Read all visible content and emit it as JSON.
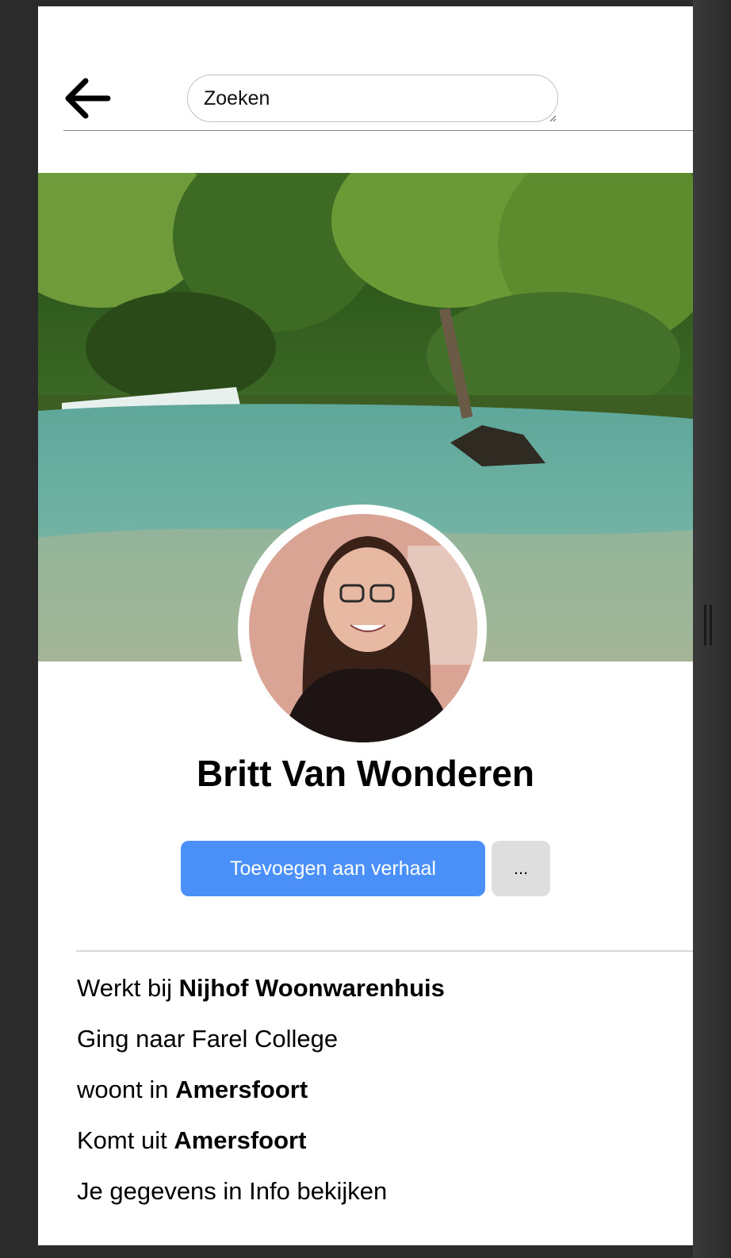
{
  "header": {
    "back_icon": "arrow-left-icon",
    "search_placeholder": "Zoeken"
  },
  "profile": {
    "cover_description": "jungle-waterfall-photo",
    "avatar_description": "profile-photo",
    "name": "Britt Van Wonderen",
    "add_story_label": "Toevoegen aan verhaal",
    "more_label": "..."
  },
  "info": {
    "work_prefix": "Werkt bij",
    "work_place": "Nijhof Woonwarenhuis",
    "school": "Ging naar Farel College",
    "lives_prefix": "woont in",
    "lives_city": "Amersfoort",
    "from_prefix": "Komt uit",
    "from_city": "Amersfoort",
    "see_info_link": "Je gegevens in Info bekijken"
  },
  "colors": {
    "primary_button": "#4a90f8",
    "secondary_button": "#dedede",
    "frame": "#2b2b2b"
  }
}
